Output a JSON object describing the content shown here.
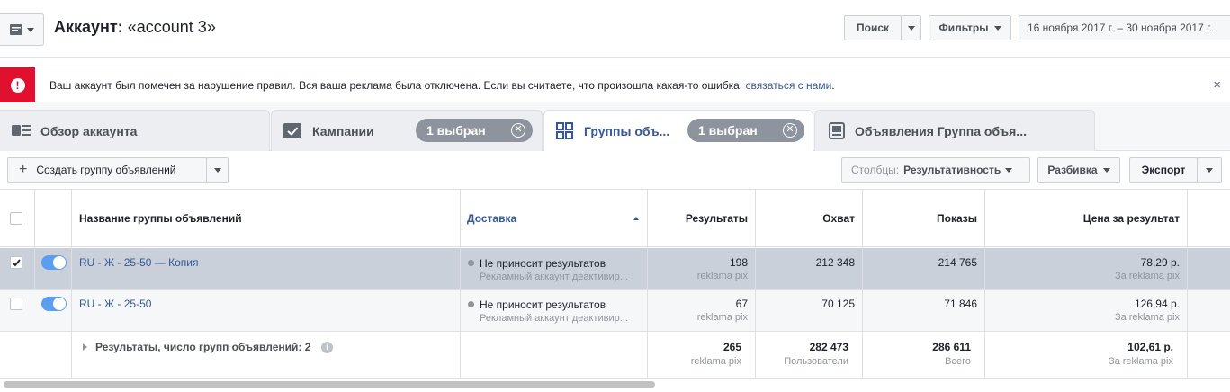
{
  "header": {
    "menu_icon": "campaigns-menu-icon",
    "account_label": "Аккаунт:",
    "account_name": "«account 3»",
    "search_label": "Поиск",
    "filters_label": "Фильтры",
    "date_range": "16 ноября 2017 г. – 30 ноября 2017 г."
  },
  "alert": {
    "icon": "alert-icon",
    "text": "Ваш аккаунт был помечен за нарушение правил. Вся ваша реклама была отключена. Если вы считаете, что произошла какая-то ошибка, ",
    "link": "связаться с нами",
    "text_end": ".",
    "close_glyph": "×"
  },
  "tabs": [
    {
      "label": "Обзор аккаунта",
      "icon": "account-overview-icon"
    },
    {
      "label": "Кампании",
      "icon": "campaigns-checkbox-icon",
      "pill": "1 выбран"
    },
    {
      "label": "Группы объ...",
      "icon": "adsets-grid-icon",
      "pill": "1 выбран",
      "active": true
    },
    {
      "label": "Объявления Группа объя...",
      "icon": "ads-icon"
    }
  ],
  "toolbar": {
    "create_label": "Создать группу объявлений",
    "columns_prefix": "Столбцы: ",
    "columns_value": "Результативность",
    "breakdown_label": "Разбивка",
    "export_label": "Экспорт"
  },
  "table": {
    "columns": {
      "name": "Название группы объявлений",
      "delivery": "Доставка",
      "results": "Результаты",
      "reach": "Охват",
      "impressions": "Показы",
      "cost": "Цена за результат"
    },
    "rows": [
      {
        "name": "RU - Ж - 25-50 — Копия",
        "selected": true,
        "delivery": "Не приносит результатов",
        "delivery_sub": "Рекламный аккаунт деактивир...",
        "results": "198",
        "results_sub": "reklama pix",
        "reach": "212 348",
        "impressions": "214 765",
        "cost": "78,29 р.",
        "cost_sub": "За reklama pix"
      },
      {
        "name": "RU - Ж - 25-50",
        "selected": false,
        "delivery": "Не приносит результатов",
        "delivery_sub": "Рекламный аккаунт деактивир...",
        "results": "67",
        "results_sub": "reklama pix",
        "reach": "70 125",
        "impressions": "71 846",
        "cost": "126,94 р.",
        "cost_sub": "За reklama pix"
      }
    ],
    "summary": {
      "label": "Результаты, число групп объявлений: 2",
      "results": "265",
      "results_sub": "reklama pix",
      "reach": "282 473",
      "reach_sub": "Пользователи",
      "impressions": "286 611",
      "impressions_sub": "Всего",
      "cost": "102,61 р.",
      "cost_sub": "За reklama pix"
    }
  },
  "colors": {
    "accent": "#365899",
    "alert": "#e0102e",
    "selected_row": "#c9d0da",
    "toggle_on": "#5b9dee"
  }
}
